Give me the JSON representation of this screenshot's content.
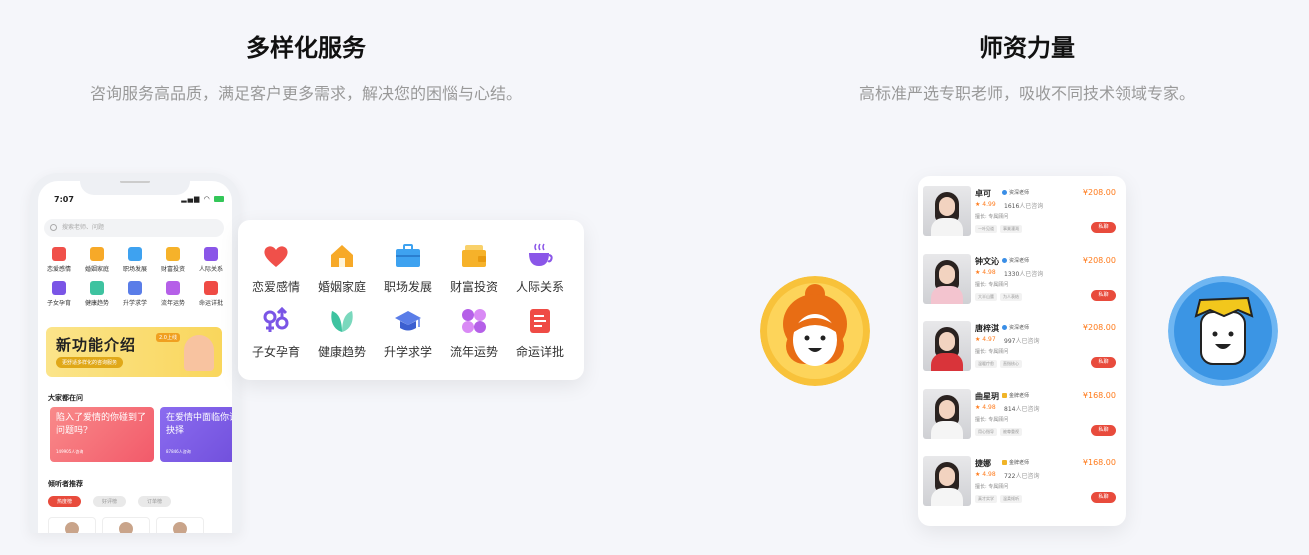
{
  "left_section": {
    "title": "多样化服务",
    "subtitle": "咨询服务高品质，满足客户更多需求，解决您的困惱与心结。"
  },
  "right_section": {
    "title": "师资力量",
    "subtitle": "高标准严选专职老师，吸收不同技术领域专家。"
  },
  "phone": {
    "time": "7:07",
    "search_placeholder": "搜索老师、问题",
    "grid": [
      {
        "label": "恋爱感情",
        "color": "#f0504a"
      },
      {
        "label": "婚姻家庭",
        "color": "#f7a928"
      },
      {
        "label": "职场发展",
        "color": "#3ea2f0"
      },
      {
        "label": "财富投资",
        "color": "#f6b22a"
      },
      {
        "label": "人际关系",
        "color": "#8a56e8"
      },
      {
        "label": "子女孕育",
        "color": "#7a55e6"
      },
      {
        "label": "健康趋势",
        "color": "#3ec3a0"
      },
      {
        "label": "升学求学",
        "color": "#5a7de8"
      },
      {
        "label": "流年运势",
        "color": "#b560e8"
      },
      {
        "label": "命运详批",
        "color": "#ef4b45"
      }
    ],
    "banner": {
      "title": "新功能介绍",
      "subtitle": "更舒适多样化的咨询服务",
      "tag": "2.0上线"
    },
    "section_questions": "大家都在问",
    "question_cards": [
      {
        "text": "陷入了爱情的你碰到了问题吗?",
        "meta": "149905人咨询"
      },
      {
        "text": "在爱情中面临你该如何抉择",
        "meta": "87846人咨询"
      }
    ],
    "section_listeners": "倾听者推荐",
    "tabs": [
      "热度榜",
      "好评榜",
      "订单榜"
    ]
  },
  "services": [
    {
      "label": "恋爱感情",
      "icon": "heart-icon",
      "color": "#f0504a"
    },
    {
      "label": "婚姻家庭",
      "icon": "house-icon",
      "color": "#f7a928"
    },
    {
      "label": "职场发展",
      "icon": "briefcase-icon",
      "color": "#3ea2f0"
    },
    {
      "label": "财富投资",
      "icon": "wallet-icon",
      "color": "#f6b22a"
    },
    {
      "label": "人际关系",
      "icon": "cup-icon",
      "color": "#8a56e8"
    },
    {
      "label": "子女孕育",
      "icon": "gender-icon",
      "color": "#7a55e6"
    },
    {
      "label": "健康趋势",
      "icon": "leaf-icon",
      "color": "#3ec3a0"
    },
    {
      "label": "升学求学",
      "icon": "graduation-cap-icon",
      "color": "#5a7de8"
    },
    {
      "label": "流年运势",
      "icon": "clover-icon",
      "color": "#b560e8"
    },
    {
      "label": "命运详批",
      "icon": "document-icon",
      "color": "#ef4b45"
    }
  ],
  "teachers": [
    {
      "name": "卓可",
      "badge": "资深老师",
      "badge_type": "blue",
      "rating": "★ 4.99",
      "count": "1616",
      "count_tail": "人已咨询",
      "skill": "擅长: 专属顾问",
      "tags": [
        "一叶见道",
        "事業灌溉"
      ],
      "price": "¥208.00",
      "button": "私聊",
      "dress": "#f4f4f4"
    },
    {
      "name": "钟文沁",
      "badge": "资深老师",
      "badge_type": "blue",
      "rating": "★ 4.98",
      "count": "1330",
      "count_tail": "人已咨询",
      "skill": "擅长: 专属顾问",
      "tags": [
        "大半山腰",
        "为人表结"
      ],
      "price": "¥208.00",
      "button": "私聊",
      "dress": "#f3c4cf"
    },
    {
      "name": "唐梓淇",
      "badge": "资深老师",
      "badge_type": "blue",
      "rating": "★ 4.97",
      "count": "997",
      "count_tail": "人已咨询",
      "skill": "擅长: 专属顾问",
      "tags": [
        "温暖疗愈",
        "直指核心"
      ],
      "price": "¥208.00",
      "button": "私聊",
      "dress": "#d9343a"
    },
    {
      "name": "曲星玥",
      "badge": "金牌老师",
      "badge_type": "gold",
      "rating": "★ 4.98",
      "count": "814",
      "count_tail": "人已咨询",
      "skill": "擅长: 专属顾问",
      "tags": [
        "用心指导",
        "被尊重视"
      ],
      "price": "¥168.00",
      "button": "私聊",
      "dress": "#f5f5f5"
    },
    {
      "name": "捷娜",
      "badge": "金牌老师",
      "badge_type": "gold",
      "rating": "★ 4.98",
      "count": "722",
      "count_tail": "人已咨询",
      "skill": "擅长: 专属顾问",
      "tags": [
        "真才实学",
        "温柔倾听"
      ],
      "price": "¥168.00",
      "button": "私聊",
      "dress": "#f5f5f5"
    }
  ]
}
